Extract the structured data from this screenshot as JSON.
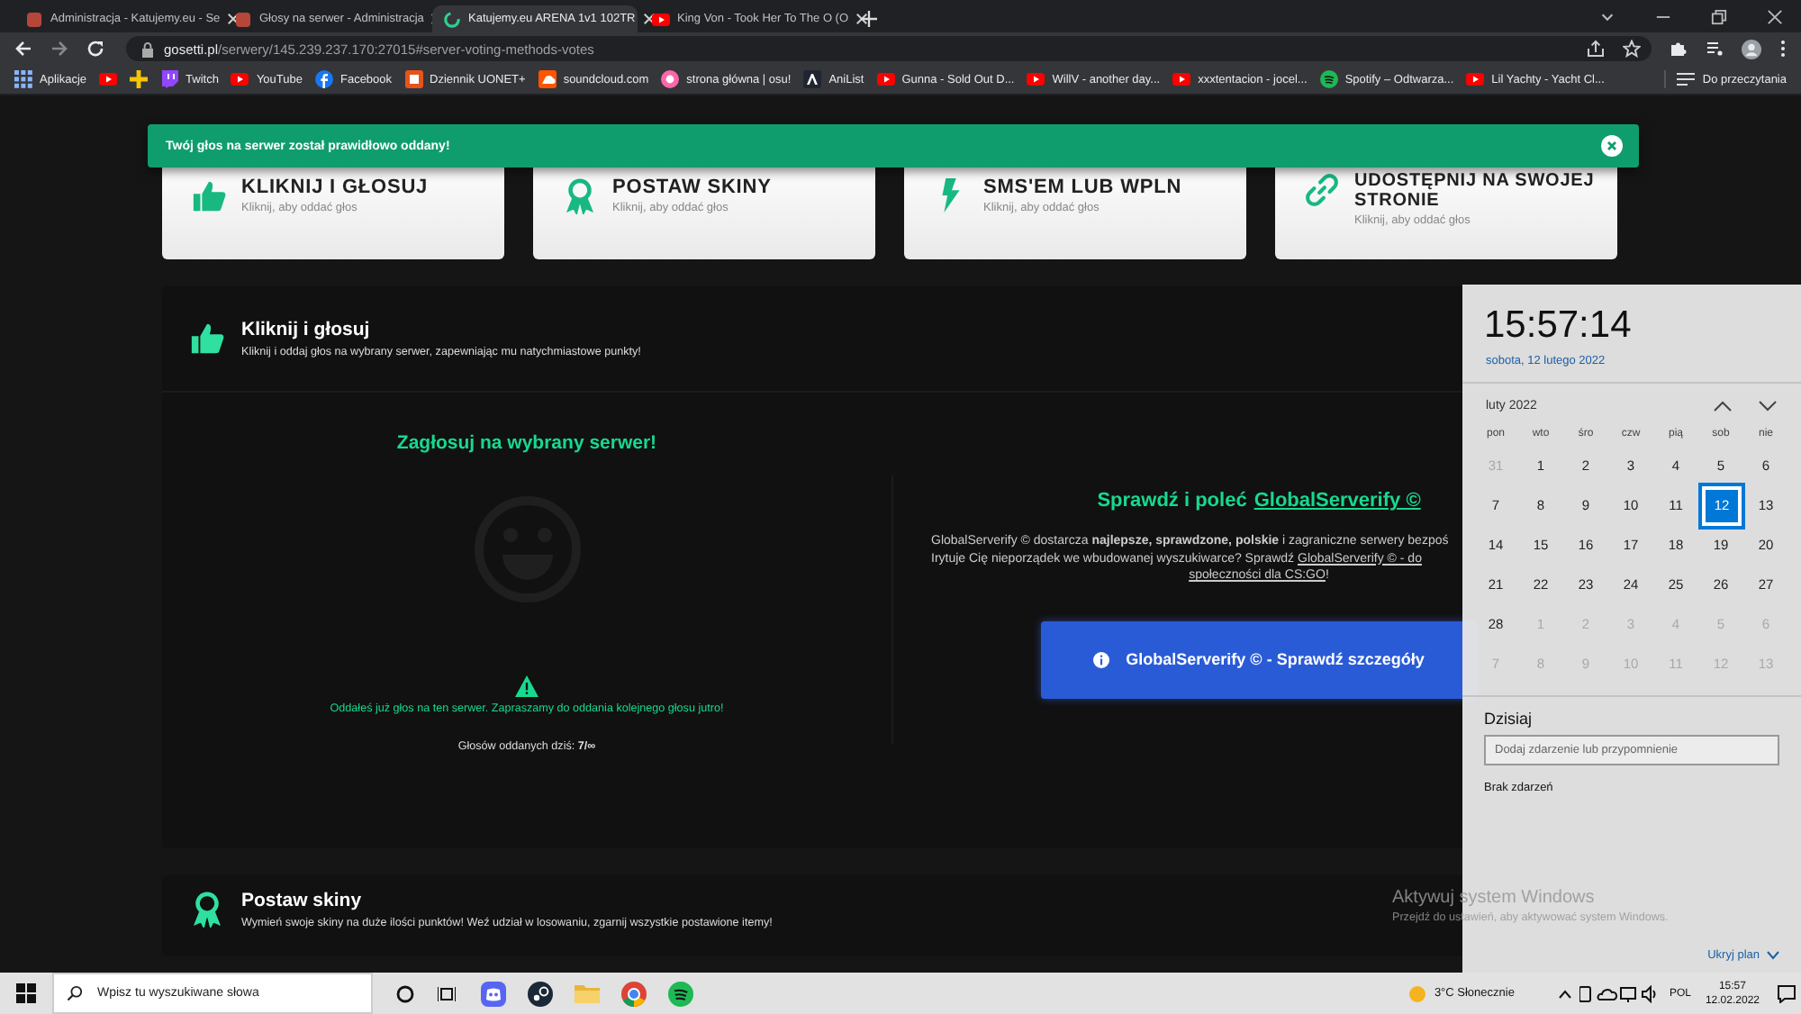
{
  "browser": {
    "tabs": [
      {
        "title": "Administracja - Katujemy.eu - Se",
        "kind": "site",
        "selected": false
      },
      {
        "title": "Głosy na serwer - Administracja",
        "kind": "site",
        "selected": false
      },
      {
        "title": "Katujemy.eu ARENA 1v1 102TR",
        "kind": "spinner",
        "selected": true
      },
      {
        "title": "King Von - Took Her To The O (O",
        "kind": "youtube",
        "selected": false
      }
    ],
    "address": {
      "domain": "gosetti.pl",
      "path": "/serwery/145.239.237.170:27015#server-voting-methods-votes"
    },
    "bookmarks": [
      {
        "label": "Aplikacje",
        "kind": "apps"
      },
      {
        "kind": "youtube"
      },
      {
        "kind": "plus"
      },
      {
        "label": "Twitch",
        "kind": "twitch"
      },
      {
        "label": "YouTube",
        "kind": "youtube"
      },
      {
        "label": "Facebook",
        "kind": "facebook"
      },
      {
        "label": "Dziennik UONET+",
        "kind": "uonet"
      },
      {
        "label": "soundcloud.com",
        "kind": "soundcloud"
      },
      {
        "label": "strona główna | osu!",
        "kind": "osu"
      },
      {
        "label": "AniList",
        "kind": "anilist"
      },
      {
        "label": "Gunna - Sold Out D...",
        "kind": "youtube"
      },
      {
        "label": "WillV - another day...",
        "kind": "youtube"
      },
      {
        "label": "xxxtentacion - jocel...",
        "kind": "youtube"
      },
      {
        "label": "Spotify – Odtwarza...",
        "kind": "spotify"
      },
      {
        "label": "Lil Yachty - Yacht Cl...",
        "kind": "youtube"
      }
    ],
    "reading_list": "Do przeczytania"
  },
  "toast": {
    "message": "Twój głos na serwer został prawidłowo oddany!"
  },
  "vote_methods": [
    {
      "title": "KLIKNIJ I GŁOSUJ",
      "subtitle": "Kliknij, aby oddać głos",
      "kind": "thumb"
    },
    {
      "title": "POSTAW SKINY",
      "subtitle": "Kliknij, aby oddać głos",
      "kind": "award"
    },
    {
      "title": "SMS'EM LUB WPLN",
      "subtitle": "Kliknij, aby oddać głos",
      "kind": "bolt"
    },
    {
      "title": "UDOSTĘPNIJ NA SWOJEJ STRONIE",
      "subtitle": "Kliknij, aby oddać głos",
      "kind": "link"
    }
  ],
  "vote_panel": {
    "title": "Kliknij i głosuj",
    "subtitle": "Kliknij i oddaj głos na wybrany serwer, zapewniając mu natychmiastowe punkty!",
    "heading": "Zagłosuj na wybrany serwer!",
    "notice": "Oddałeś już głos na ten serwer. Zapraszamy do oddania kolejnego głosu jutro!",
    "votes_today": "Głosów oddanych dziś: **7/∞**",
    "promo": {
      "heading": "Sprawdź i poleć",
      "heading_link": "GlobalServerify ©",
      "lines": [
        [
          {
            "text": "GlobalServerify © dostarcza **najlepsze, sprawdzone, polskie** i zagraniczne serwery bezpoś"
          }
        ],
        [
          {
            "text": "Irytuje Cię nieporządek we wbudowanej wyszukiwarce? Sprawdź "
          },
          {
            "text": "GlobalServerify © - do",
            "link": true
          }
        ],
        [
          {
            "text": "społeczności dla CS:GO",
            "link": true
          },
          {
            "text": "!"
          }
        ]
      ],
      "button": "GlobalServerify © - Sprawdź szczegóły"
    }
  },
  "skins_panel": {
    "title": "Postaw skiny",
    "subtitle": "Wymień swoje skiny na duże ilości punktów! Weź udział w losowaniu, zgarnij wszystkie postawione itemy!"
  },
  "calendar_flyout": {
    "time": "15:57:14",
    "date": "sobota, 12 lutego 2022",
    "month": "luty 2022",
    "weekdays": [
      "pon",
      "wto",
      "śro",
      "czw",
      "pią",
      "sob",
      "nie"
    ],
    "days": [
      {
        "label": "31",
        "in_month": false,
        "selected": false
      },
      {
        "label": "1",
        "in_month": true,
        "selected": false
      },
      {
        "label": "2",
        "in_month": true,
        "selected": false
      },
      {
        "label": "3",
        "in_month": true,
        "selected": false
      },
      {
        "label": "4",
        "in_month": true,
        "selected": false
      },
      {
        "label": "5",
        "in_month": true,
        "selected": false
      },
      {
        "label": "6",
        "in_month": true,
        "selected": false
      },
      {
        "label": "7",
        "in_month": true,
        "selected": false
      },
      {
        "label": "8",
        "in_month": true,
        "selected": false
      },
      {
        "label": "9",
        "in_month": true,
        "selected": false
      },
      {
        "label": "10",
        "in_month": true,
        "selected": false
      },
      {
        "label": "11",
        "in_month": true,
        "selected": false
      },
      {
        "label": "12",
        "in_month": true,
        "selected": true
      },
      {
        "label": "13",
        "in_month": true,
        "selected": false
      },
      {
        "label": "14",
        "in_month": true,
        "selected": false
      },
      {
        "label": "15",
        "in_month": true,
        "selected": false
      },
      {
        "label": "16",
        "in_month": true,
        "selected": false
      },
      {
        "label": "17",
        "in_month": true,
        "selected": false
      },
      {
        "label": "18",
        "in_month": true,
        "selected": false
      },
      {
        "label": "19",
        "in_month": true,
        "selected": false
      },
      {
        "label": "20",
        "in_month": true,
        "selected": false
      },
      {
        "label": "21",
        "in_month": true,
        "selected": false
      },
      {
        "label": "22",
        "in_month": true,
        "selected": false
      },
      {
        "label": "23",
        "in_month": true,
        "selected": false
      },
      {
        "label": "24",
        "in_month": true,
        "selected": false
      },
      {
        "label": "25",
        "in_month": true,
        "selected": false
      },
      {
        "label": "26",
        "in_month": true,
        "selected": false
      },
      {
        "label": "27",
        "in_month": true,
        "selected": false
      },
      {
        "label": "28",
        "in_month": true,
        "selected": false
      },
      {
        "label": "1",
        "in_month": false,
        "selected": false
      },
      {
        "label": "2",
        "in_month": false,
        "selected": false
      },
      {
        "label": "3",
        "in_month": false,
        "selected": false
      },
      {
        "label": "4",
        "in_month": false,
        "selected": false
      },
      {
        "label": "5",
        "in_month": false,
        "selected": false
      },
      {
        "label": "6",
        "in_month": false,
        "selected": false
      },
      {
        "label": "7",
        "in_month": false,
        "selected": false
      },
      {
        "label": "8",
        "in_month": false,
        "selected": false
      },
      {
        "label": "9",
        "in_month": false,
        "selected": false
      },
      {
        "label": "10",
        "in_month": false,
        "selected": false
      },
      {
        "label": "11",
        "in_month": false,
        "selected": false
      },
      {
        "label": "12",
        "in_month": false,
        "selected": false
      },
      {
        "label": "13",
        "in_month": false,
        "selected": false
      }
    ],
    "agenda_title": "Dzisiaj",
    "agenda_placeholder": "Dodaj zdarzenie lub przypomnienie",
    "agenda_empty": "Brak zdarzeń",
    "hide_plan": "Ukryj plan"
  },
  "activation_notice": {
    "title": "Aktywuj system Windows",
    "text": "Przejdź do ustawień, aby aktywować system Windows."
  },
  "taskbar": {
    "search_placeholder": "Wpisz tu wyszukiwane słowa",
    "apps": [
      {
        "kind": "discord"
      },
      {
        "kind": "steam"
      },
      {
        "kind": "folder"
      },
      {
        "kind": "chrome"
      },
      {
        "kind": "spotify"
      }
    ],
    "weather": "3°C Słonecznie",
    "language": "POL",
    "time": "15:57",
    "date": "12.02.2022"
  }
}
